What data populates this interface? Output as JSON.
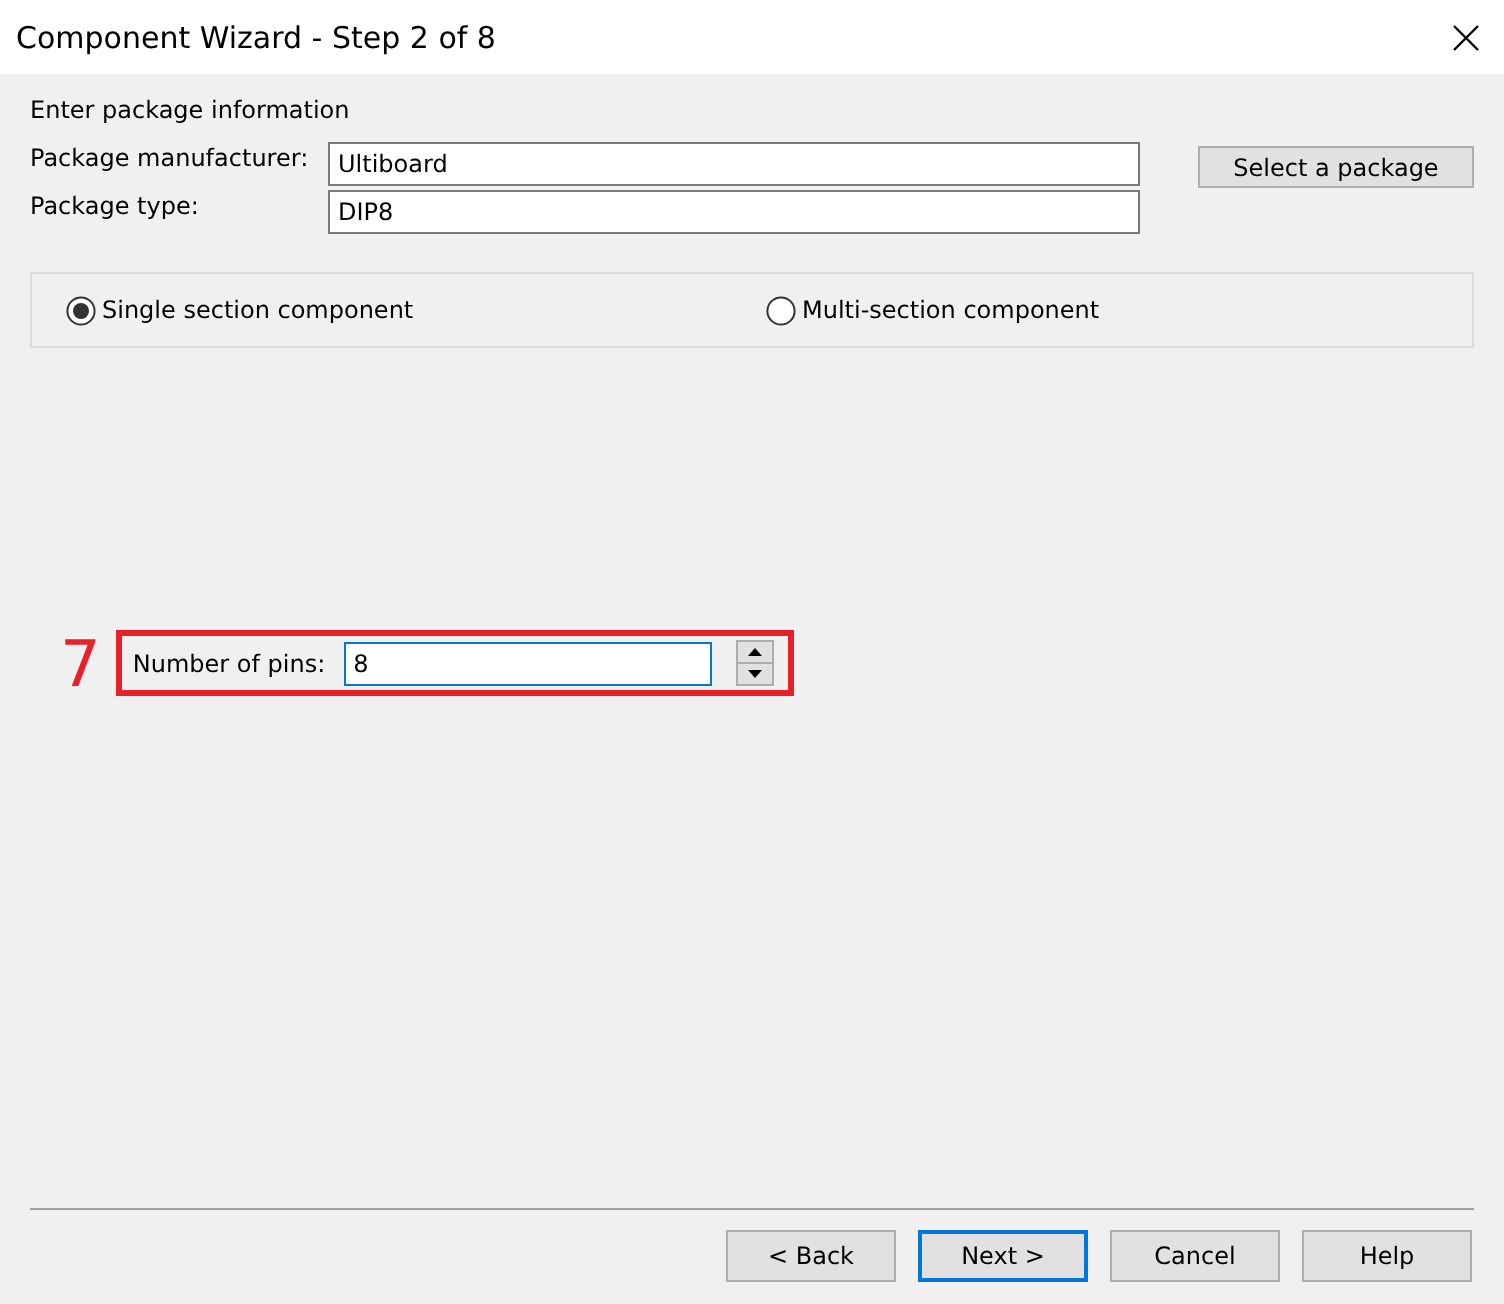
{
  "window": {
    "title": "Component Wizard - Step 2 of 8"
  },
  "section_heading": "Enter package information",
  "fields": [
    {
      "label": "Package manufacturer:",
      "value": "Ultiboard"
    },
    {
      "label": "Package type:",
      "value": "DIP8"
    }
  ],
  "select_button": "Select a package",
  "section_options": [
    {
      "label": "Single section component",
      "selected": true
    },
    {
      "label": "Multi-section component",
      "selected": false
    }
  ],
  "annotation": "7",
  "pins": {
    "label": "Number of pins:",
    "value": "8"
  },
  "buttons": [
    {
      "label": "< Back",
      "selected": false
    },
    {
      "label": "Next >",
      "selected": true
    },
    {
      "label": "Cancel",
      "selected": false
    },
    {
      "label": "Help",
      "selected": false
    }
  ]
}
